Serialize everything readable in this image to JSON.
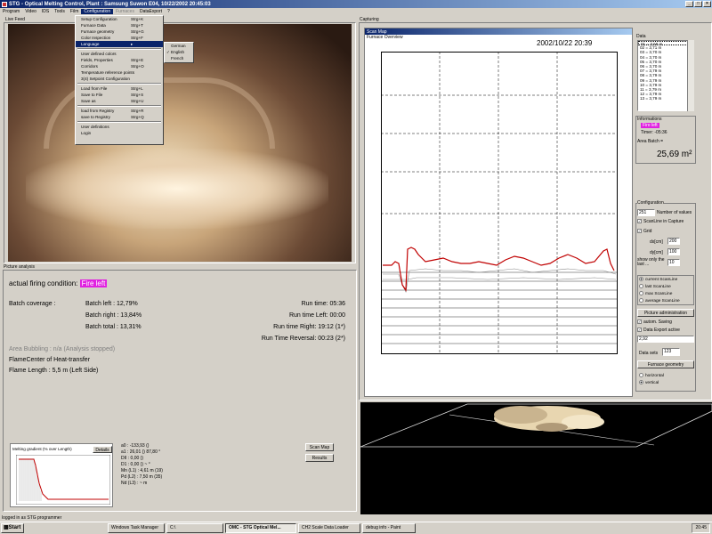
{
  "title": "STG - Optical Melting Control, Plant : Samsung Suwon E04, 10/22/2002 20:45:03",
  "menu": [
    "Program",
    "Video",
    "IDS",
    "Tools",
    "Film",
    "Configuration",
    "Furnaces",
    "DataExport",
    "?"
  ],
  "dropdown": [
    {
      "label": "Setup Configuration",
      "shortcut": "Strg+K"
    },
    {
      "label": "Furnace Data",
      "shortcut": "Strg+T"
    },
    {
      "label": "Furnace geometry",
      "shortcut": "Strg+G"
    },
    {
      "label": "Color Inspection",
      "shortcut": "Strg+F"
    },
    {
      "label": "Language",
      "shortcut": "▸"
    },
    {
      "sep": true
    },
    {
      "label": "User defined colors",
      "shortcut": ""
    },
    {
      "label": "Fields, Properties",
      "shortcut": "Strg+E"
    },
    {
      "label": "Corridors",
      "shortcut": "Strg+O"
    },
    {
      "label": "Temperature reference points",
      "shortcut": ""
    },
    {
      "label": "3(4) Setpoint Configuration",
      "shortcut": ""
    },
    {
      "sep": true
    },
    {
      "label": "Load from File",
      "shortcut": "Strg+L"
    },
    {
      "label": "Save to File",
      "shortcut": "Strg+S"
    },
    {
      "label": "Save as",
      "shortcut": "Strg+U"
    },
    {
      "sep": true
    },
    {
      "label": "load from Registry",
      "shortcut": "Strg+R"
    },
    {
      "label": "save to Registry",
      "shortcut": "Strg+Q"
    },
    {
      "sep": true
    },
    {
      "label": "User definitions",
      "shortcut": ""
    },
    {
      "label": "Login",
      "shortcut": ""
    }
  ],
  "languages": [
    {
      "label": "German",
      "checked": false
    },
    {
      "label": "English",
      "checked": true
    },
    {
      "label": "French",
      "checked": false
    }
  ],
  "live_feed_label": "Live Feed",
  "capturing_label": "Capturing",
  "picture_analysis_label": "Picture analysis",
  "analysis": {
    "firing_prefix": "actual firing condition:",
    "firing_value": "Fire left",
    "batch_coverage_label": "Batch coverage  :",
    "batch_left": "Batch left  : 12,79%",
    "batch_right": "Batch right : 13,84%",
    "batch_total": "Batch total : 13,31%",
    "run_time": "Run time:  05:36",
    "run_time_left": "Run time Left:  00:00",
    "run_time_right": "Run time Right:  19:12 (1*)",
    "run_time_reversal": "Run Time Reversal:  00:23 (2*)",
    "area_bubbling": "Area Bubbling :  n/a  (Analysis stopped)",
    "flame_center": "FlameCenter of Heat-transfer",
    "flame_length": "Flame Length : 5,5 m  (Left Side)"
  },
  "melting": {
    "label": "Melting gradient (% over Length)",
    "details": "Details"
  },
  "stats": [
    "a0   : -133,93 ()",
    "a1   : 26,01 () 87,80 °",
    "DII  : 0,00 ()",
    "D1   : 0,00 () ~ °",
    "Mn (L1) : 4,61 m (19)",
    "Pd (L2) : 7,50 m (35)",
    "Nd (L3) : ~ m"
  ],
  "scan_map_button": "Scan Map",
  "results_button": "Results",
  "capture_window": {
    "title": "Scan Map",
    "subtitle": "Furnace Overview",
    "timestamp": "2002/10/22 20:39"
  },
  "data_panel": {
    "label": "Data",
    "items": [
      "01 = 3,66 m",
      "02 = 3,71 m",
      "03 = 3,70 m",
      "04 = 3,70 m",
      "05 = 3,70 m",
      "06 = 3,70 m",
      "07 = 3,79 m",
      "08 = 3,79 m",
      "09 = 3,79 m",
      "10 = 3,79 m",
      "11 = 3,79 m",
      "12 = 3,79 m",
      "13 = 3,79 m"
    ]
  },
  "information": {
    "label": "Informations",
    "fire": "Fire left",
    "timer": "Timer: -05:36",
    "area_batch_label": "Area Batch =",
    "area_batch_value": "25,69 m²"
  },
  "configuration": {
    "label": "Configuration",
    "num_values": "251",
    "num_values_label": "Number of values",
    "scanline_capture": "ScanLine in Capture",
    "grid": "Grid",
    "dx_label": "dx[cm]",
    "dx": "200",
    "dy_label": "dy[cm]",
    "dy": "100",
    "show_only_label": "show only the last ...",
    "show_only": "10",
    "radios": [
      "current ScanLine",
      "last ScanLine",
      "max ScanLine",
      "average ScanLine"
    ],
    "picture_admin": "Picture administration",
    "auto_saving": "autom. Saving",
    "data_export_active": "Data Export active",
    "export_value": "2,92",
    "data_sets_label": "Data sets",
    "data_sets": "123",
    "furnace_geometry": "Furnace geometry",
    "orient": [
      "horizontal",
      "vertical"
    ]
  },
  "status": "logged in as STG programmer",
  "taskbar": {
    "start": "Start",
    "items": [
      "Windows Task Manager",
      "C:\\",
      "OMC - STG Optical Mel...",
      "CH2  Scale  Data  Loader",
      "debug info - Paint"
    ],
    "clock": "20:45"
  },
  "colors": {
    "fire": "#e020e0",
    "series": "#c00000",
    "titlebar": "#0a246a"
  }
}
